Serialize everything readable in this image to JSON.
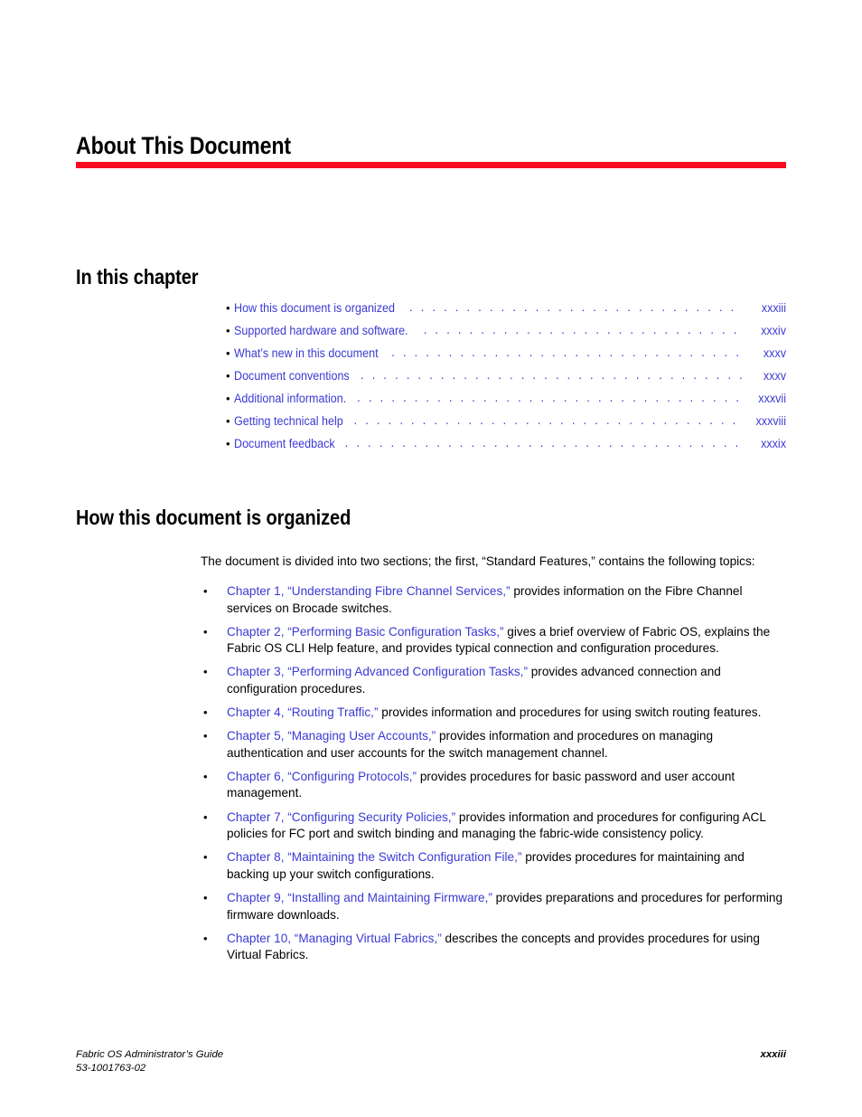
{
  "colors": {
    "rule": "#f60c1e",
    "link": "#3a3ad4",
    "text": "#000000"
  },
  "chapter": {
    "title": "About This Document"
  },
  "in_this_chapter": {
    "heading": "In this chapter",
    "entries": [
      {
        "label": "How this document is organized",
        "page": "xxxiii"
      },
      {
        "label": "Supported hardware and software.",
        "page": "xxxiv"
      },
      {
        "label": "What’s new in this document",
        "page": "xxxv"
      },
      {
        "label": "Document conventions",
        "page": "xxxv"
      },
      {
        "label": "Additional information.",
        "page": "xxxvii"
      },
      {
        "label": "Getting technical help",
        "page": "xxxviii"
      },
      {
        "label": "Document feedback",
        "page": "xxxix"
      }
    ]
  },
  "how_organized": {
    "heading": "How this document is organized",
    "intro": "The document is divided into two sections; the first, “Standard Features,” contains the following topics:",
    "items": [
      {
        "link": "Chapter 1, “Understanding Fibre Channel Services,”",
        "text": " provides information on the Fibre Channel services on Brocade switches."
      },
      {
        "link": "Chapter 2, “Performing Basic Configuration Tasks,”",
        "text": " gives a brief overview of Fabric OS, explains the Fabric OS CLI Help feature, and provides typical connection and configuration procedures."
      },
      {
        "link": "Chapter 3, “Performing Advanced Configuration Tasks,”",
        "text": " provides advanced connection and configuration procedures."
      },
      {
        "link": "Chapter 4, “Routing Traffic,”",
        "text": " provides information and procedures for using switch routing features."
      },
      {
        "link": "Chapter 5, “Managing User Accounts,”",
        "text": " provides information and procedures on managing authentication and user accounts for the switch management channel."
      },
      {
        "link": "Chapter 6, “Configuring Protocols,”",
        "text": " provides procedures for basic password and user account management."
      },
      {
        "link": "Chapter 7, “Configuring Security Policies,”",
        "text": " provides information and procedures for configuring ACL policies for FC port and switch binding and managing the fabric-wide consistency policy."
      },
      {
        "link": "Chapter 8, “Maintaining the Switch Configuration File,”",
        "text": " provides procedures for maintaining and backing up your switch configurations."
      },
      {
        "link": "Chapter 9, “Installing and Maintaining Firmware,”",
        "text": " provides preparations and procedures for performing firmware downloads."
      },
      {
        "link": "Chapter 10, “Managing Virtual Fabrics,”",
        "text": " describes the concepts and provides procedures for using Virtual Fabrics."
      }
    ]
  },
  "footer": {
    "left": "Fabric OS Administrator’s Guide\n53-1001763-02",
    "page": "xxxiii"
  },
  "leader_dots": ". . . . . . . . . . . . . . . . . . . . . . . . . . . . . . . . . . . . . . . . . . . . . . . . . . . . . . . . . . . . . . . ."
}
